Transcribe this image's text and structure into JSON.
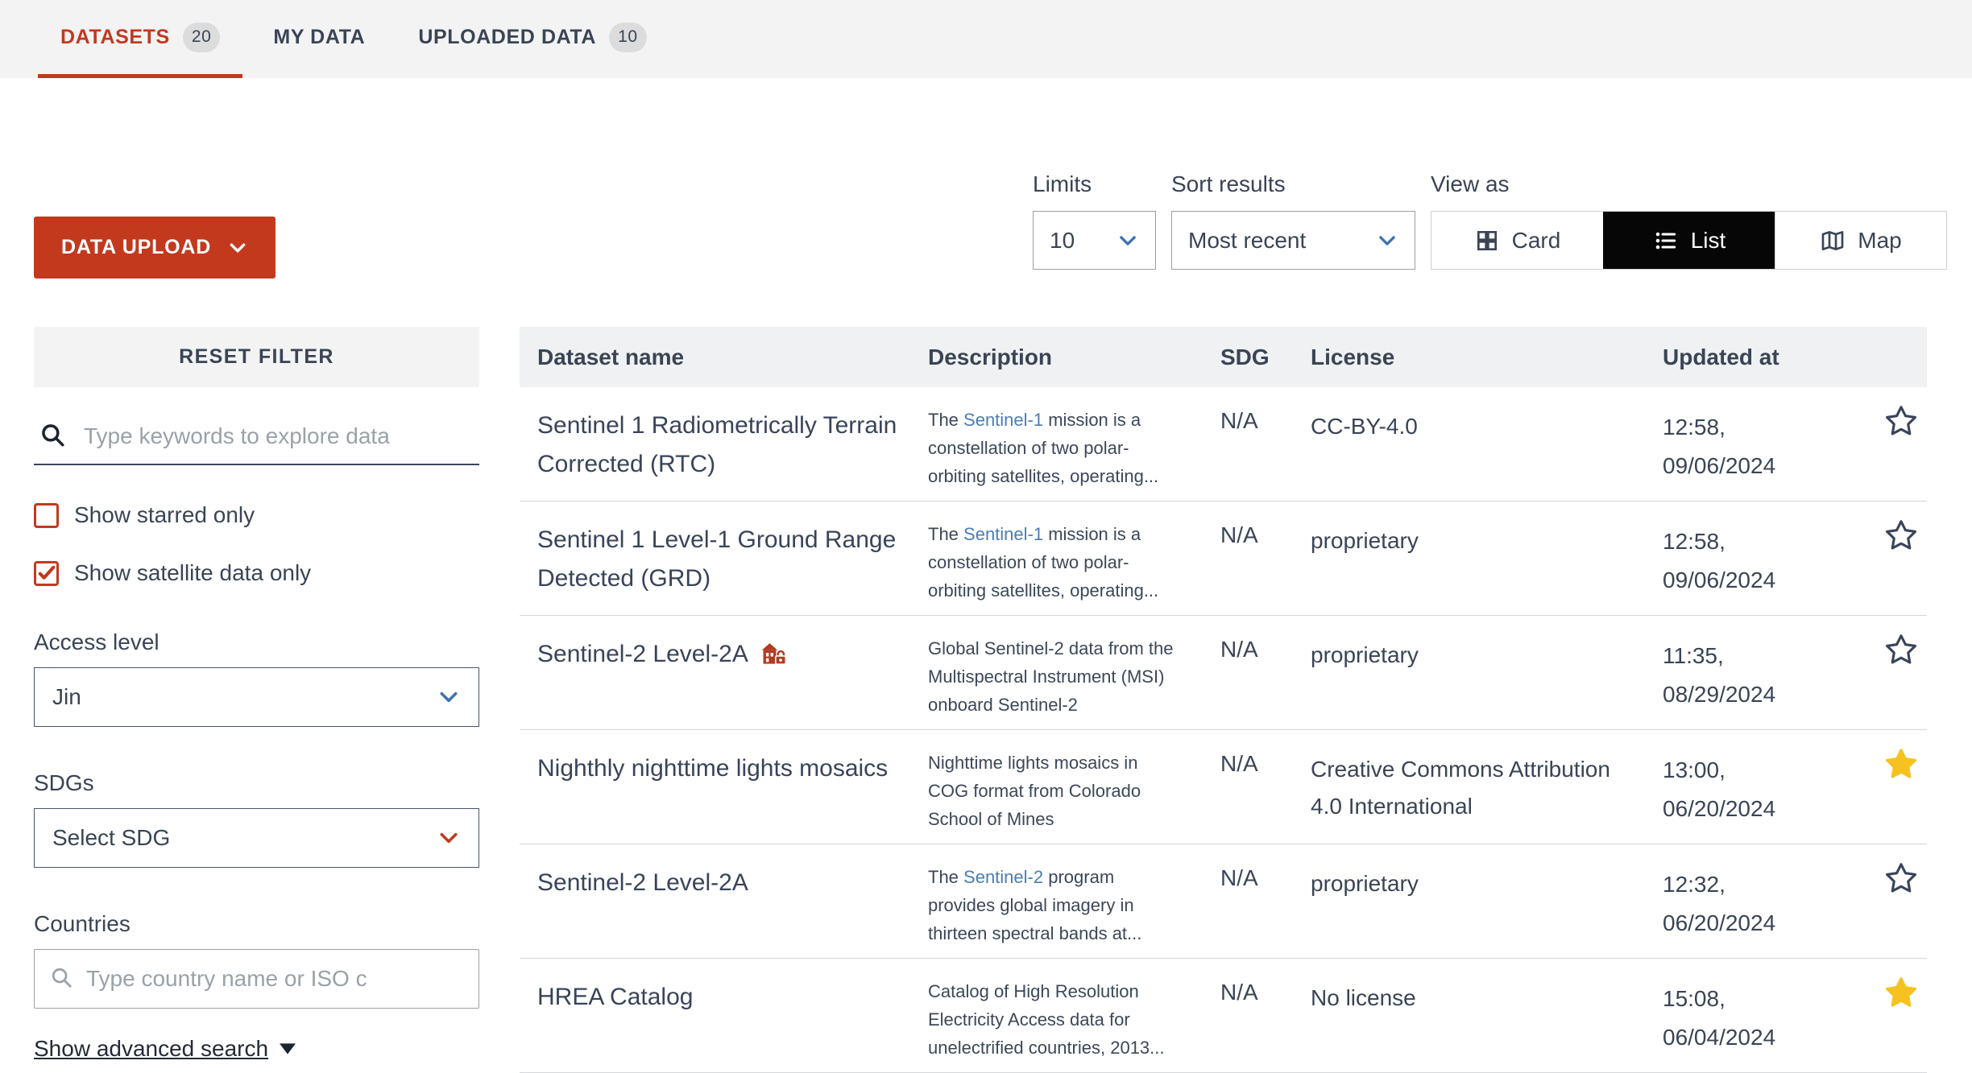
{
  "tabs": [
    {
      "label": "DATASETS",
      "badge": "20",
      "active": true
    },
    {
      "label": "MY DATA",
      "badge": "",
      "active": false
    },
    {
      "label": "UPLOADED DATA",
      "badge": "10",
      "active": false
    }
  ],
  "toolbar": {
    "upload_label": "DATA UPLOAD",
    "limits_label": "Limits",
    "limits_value": "10",
    "sort_label": "Sort results",
    "sort_value": "Most recent",
    "view_label": "View as",
    "view_options": [
      {
        "label": "Card",
        "active": false
      },
      {
        "label": "List",
        "active": true
      },
      {
        "label": "Map",
        "active": false
      }
    ]
  },
  "filters": {
    "reset_label": "RESET FILTER",
    "keyword_placeholder": "Type keywords to explore data",
    "checkboxes": [
      {
        "label": "Show starred only",
        "checked": false
      },
      {
        "label": "Show satellite data only",
        "checked": true
      }
    ],
    "access_level_label": "Access level",
    "access_level_value": "Jin",
    "sdgs_label": "SDGs",
    "sdg_value": "Select SDG",
    "countries_label": "Countries",
    "country_placeholder": "Type country name or ISO c",
    "advanced_search_label": "Show advanced search"
  },
  "table": {
    "columns": [
      "Dataset name",
      "Description",
      "SDG",
      "License",
      "Updated at"
    ],
    "rows": [
      {
        "name": "Sentinel 1 Radiometrically Terrain Corrected (RTC)",
        "desc_pre": "The ",
        "desc_link": "Sentinel-1",
        "desc_post": " mission is a constellation of two polar-orbiting satellites, operating...",
        "sdg": "N/A",
        "license": "CC-BY-4.0",
        "updated_time": "12:58,",
        "updated_date": "09/06/2024",
        "starred": false,
        "restricted": false
      },
      {
        "name": "Sentinel 1 Level-1 Ground Range Detected (GRD)",
        "desc_pre": "The ",
        "desc_link": "Sentinel-1",
        "desc_post": " mission is a constellation of two polar-orbiting satellites, operating...",
        "sdg": "N/A",
        "license": "proprietary",
        "updated_time": "12:58,",
        "updated_date": "09/06/2024",
        "starred": false,
        "restricted": false
      },
      {
        "name": "Sentinel-2 Level-2A",
        "desc_pre": "Global Sentinel-2 data from the Multispectral Instrument (MSI) onboard Sentinel-2",
        "desc_link": "",
        "desc_post": "",
        "sdg": "N/A",
        "license": "proprietary",
        "updated_time": "11:35,",
        "updated_date": "08/29/2024",
        "starred": false,
        "restricted": true
      },
      {
        "name": "Nighthly nighttime lights mosaics",
        "desc_pre": "Nighttime lights mosaics in COG format from Colorado School of Mines",
        "desc_link": "",
        "desc_post": "",
        "sdg": "N/A",
        "license": "Creative Commons Attribution 4.0 International",
        "updated_time": "13:00,",
        "updated_date": "06/20/2024",
        "starred": true,
        "restricted": false
      },
      {
        "name": "Sentinel-2 Level-2A",
        "desc_pre": "The ",
        "desc_link": "Sentinel-2",
        "desc_post": " program provides global imagery in thirteen spectral bands at...",
        "sdg": "N/A",
        "license": "proprietary",
        "updated_time": "12:32,",
        "updated_date": "06/20/2024",
        "starred": false,
        "restricted": false
      },
      {
        "name": "HREA Catalog",
        "desc_pre": "Catalog of High Resolution Electricity Access data for unelectrified countries, 2013...",
        "desc_link": "",
        "desc_post": "",
        "sdg": "N/A",
        "license": "No license",
        "updated_time": "15:08,",
        "updated_date": "06/04/2024",
        "starred": true,
        "restricted": false
      }
    ]
  },
  "colors": {
    "accent_red": "#c2391e",
    "link_blue": "#4a7db5",
    "star_yellow": "#f6c21f"
  }
}
